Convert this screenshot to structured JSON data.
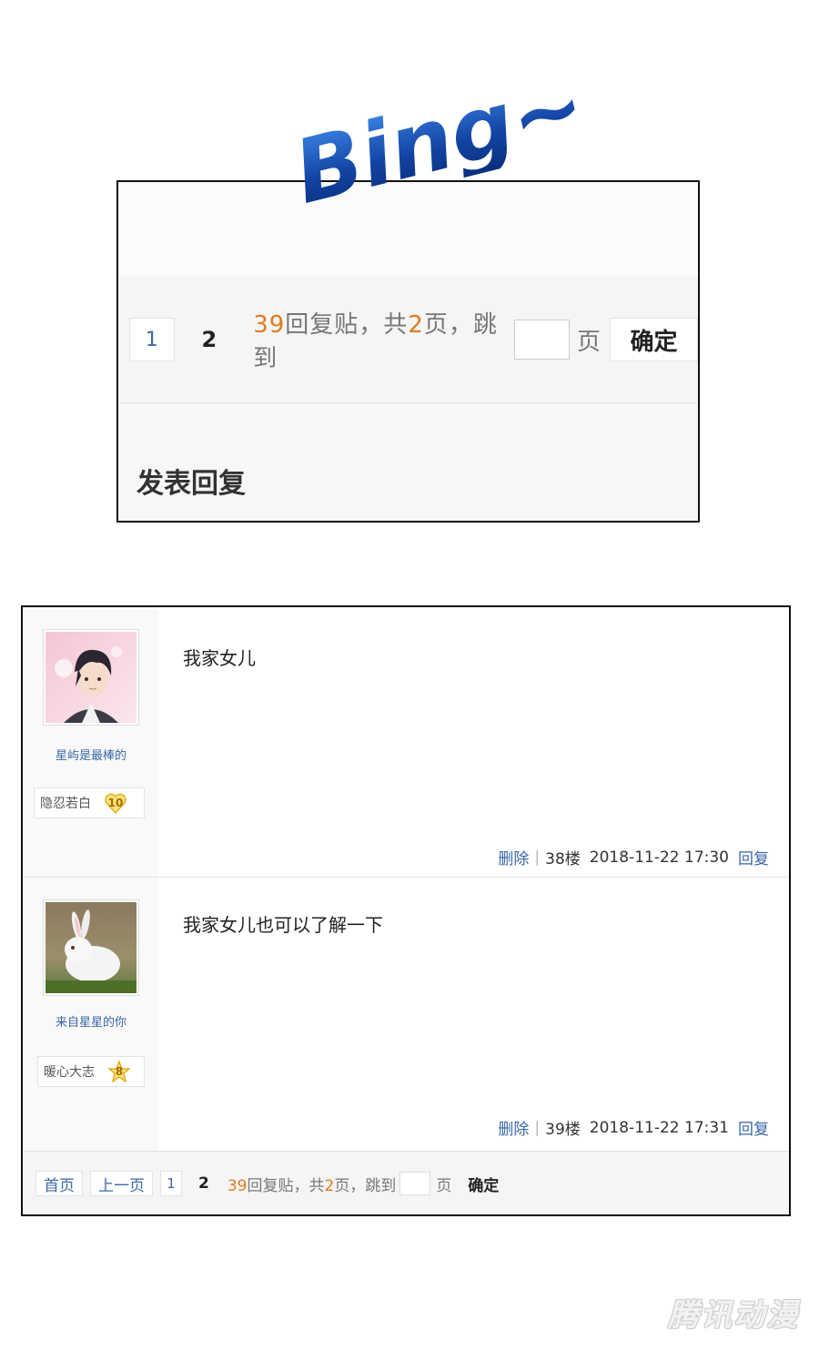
{
  "top_panel": {
    "overlay_text": "Bing~",
    "pager": {
      "page_1": "1",
      "current_page": "2",
      "reply_count": "39",
      "reply_label": "回复贴，共",
      "total_pages": "2",
      "pages_jump_label": "页，跳到",
      "page_word": "页",
      "confirm_label": "确定"
    },
    "reply_heading": "发表回复"
  },
  "posts": [
    {
      "username": "星屿是最棒的",
      "rank_title": "隐忍若白",
      "level": "10",
      "content": "我家女儿",
      "delete_label": "删除",
      "floor": "38楼",
      "timestamp": "2018-11-22 17:30",
      "reply_label": "回复"
    },
    {
      "username": "来自星星的你",
      "rank_title": "暖心大志",
      "level": "8",
      "content": "我家女儿也可以了解一下",
      "delete_label": "删除",
      "floor": "39楼",
      "timestamp": "2018-11-22 17:31",
      "reply_label": "回复"
    }
  ],
  "bottom_pager": {
    "first_label": "首页",
    "prev_label": "上一页",
    "page_1": "1",
    "current_page": "2",
    "reply_count": "39",
    "reply_label": "回复贴，共",
    "total_pages": "2",
    "pages_jump_label": "页，跳到",
    "page_word": "页",
    "confirm_label": "确定"
  },
  "watermark": "腾讯动漫",
  "colors": {
    "link": "#3866a8",
    "accent_orange": "#e07b1d",
    "bing_blue": "#1a4fb0"
  }
}
